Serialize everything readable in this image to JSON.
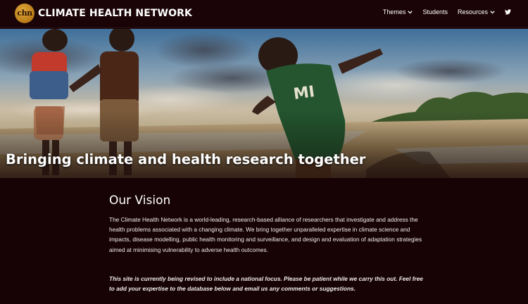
{
  "header": {
    "logo_text": "chn",
    "brand": "CLIMATE HEALTH NETWORK",
    "nav": [
      {
        "label": "Themes",
        "has_dropdown": true
      },
      {
        "label": "Students",
        "has_dropdown": false
      },
      {
        "label": "Resources",
        "has_dropdown": true
      }
    ],
    "social_icon": "twitter-icon"
  },
  "hero": {
    "title": "Bringing climate and health research together",
    "image_description_icon": "hero-photo"
  },
  "main": {
    "heading": "Our Vision",
    "body": "The Climate Health Network is a world-leading, research-based alliance of researchers that investigate and address the health problems associated with a changing climate. We bring together unparalleled expertise in climate science and impacts, disease modelling, public health monitoring and surveillance, and design and evaluation of adaptation strategies aimed at minimising vulnerability to adverse health outcomes.",
    "notice": "This site is currently being revised to include a national focus. Please be patient while we carry this out. Feel free to add your expertise to the database below and email us any comments or suggestions."
  },
  "colors": {
    "background": "#170306",
    "header": "#1a0407",
    "logo_gold": "#c48a22",
    "text": "#ffffff"
  }
}
